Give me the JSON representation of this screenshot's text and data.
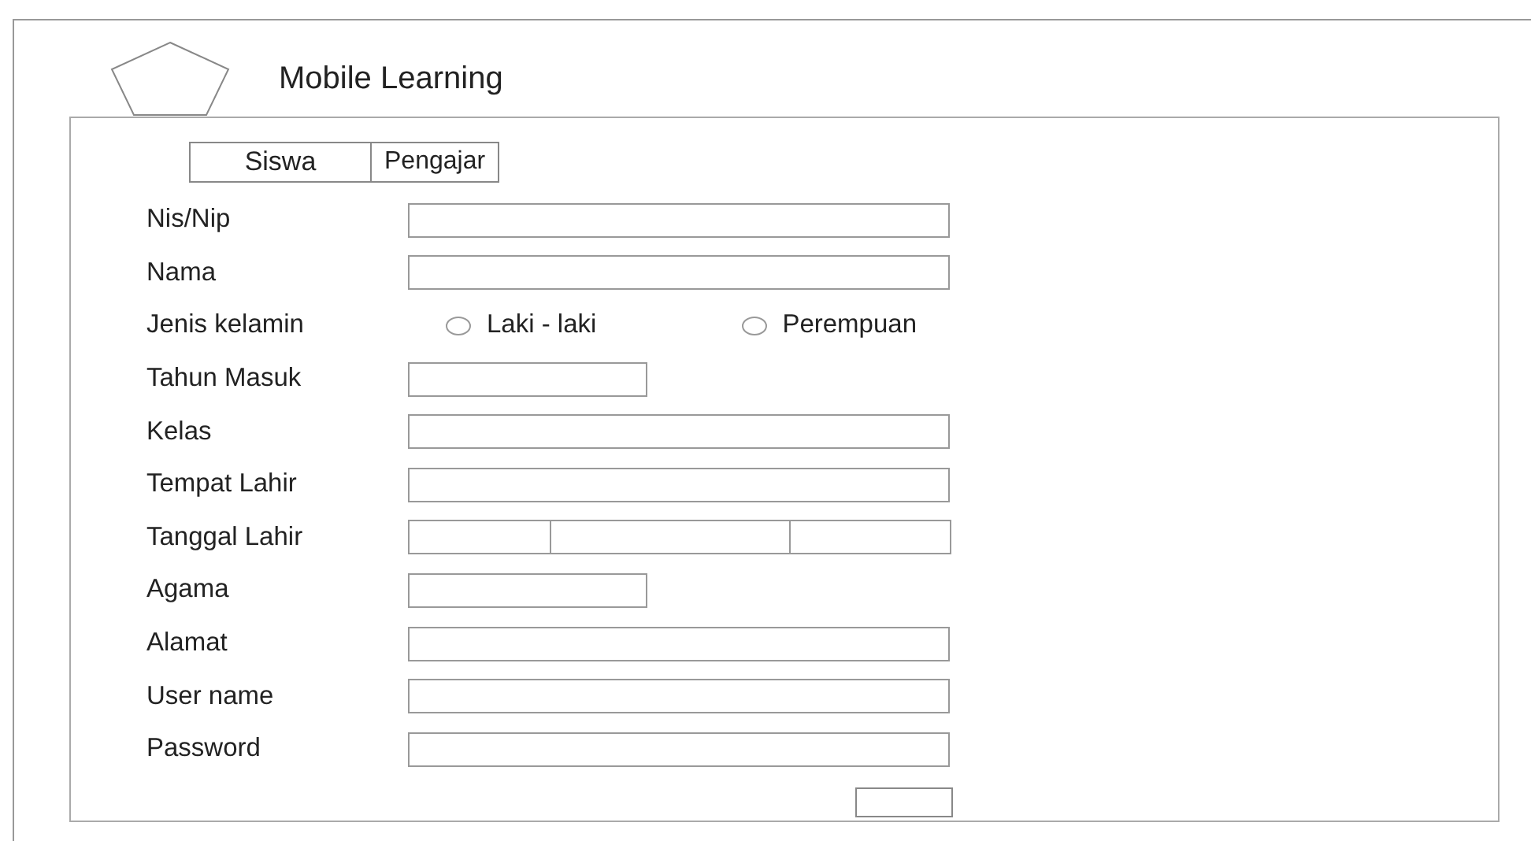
{
  "header": {
    "title": "Mobile Learning"
  },
  "tabs": [
    {
      "label": "Siswa",
      "selected": false
    },
    {
      "label": "Pengajar",
      "selected": false
    }
  ],
  "fields": [
    {
      "kind": "text",
      "label": "Nis/Nip"
    },
    {
      "kind": "text",
      "label": "Nama"
    },
    {
      "kind": "radio",
      "label": "Jenis kelamin",
      "options": [
        {
          "label": "Laki - laki",
          "selected": false
        },
        {
          "label": "Perempuan",
          "selected": false
        }
      ]
    },
    {
      "kind": "short",
      "label": "Tahun Masuk"
    },
    {
      "kind": "text",
      "label": "Kelas"
    },
    {
      "kind": "text",
      "label": "Tempat Lahir"
    },
    {
      "kind": "date",
      "label": "Tanggal Lahir"
    },
    {
      "kind": "short",
      "label": "Agama"
    },
    {
      "kind": "text",
      "label": "Alamat"
    },
    {
      "kind": "text",
      "label": "User name"
    },
    {
      "kind": "text",
      "label": "Password"
    }
  ]
}
